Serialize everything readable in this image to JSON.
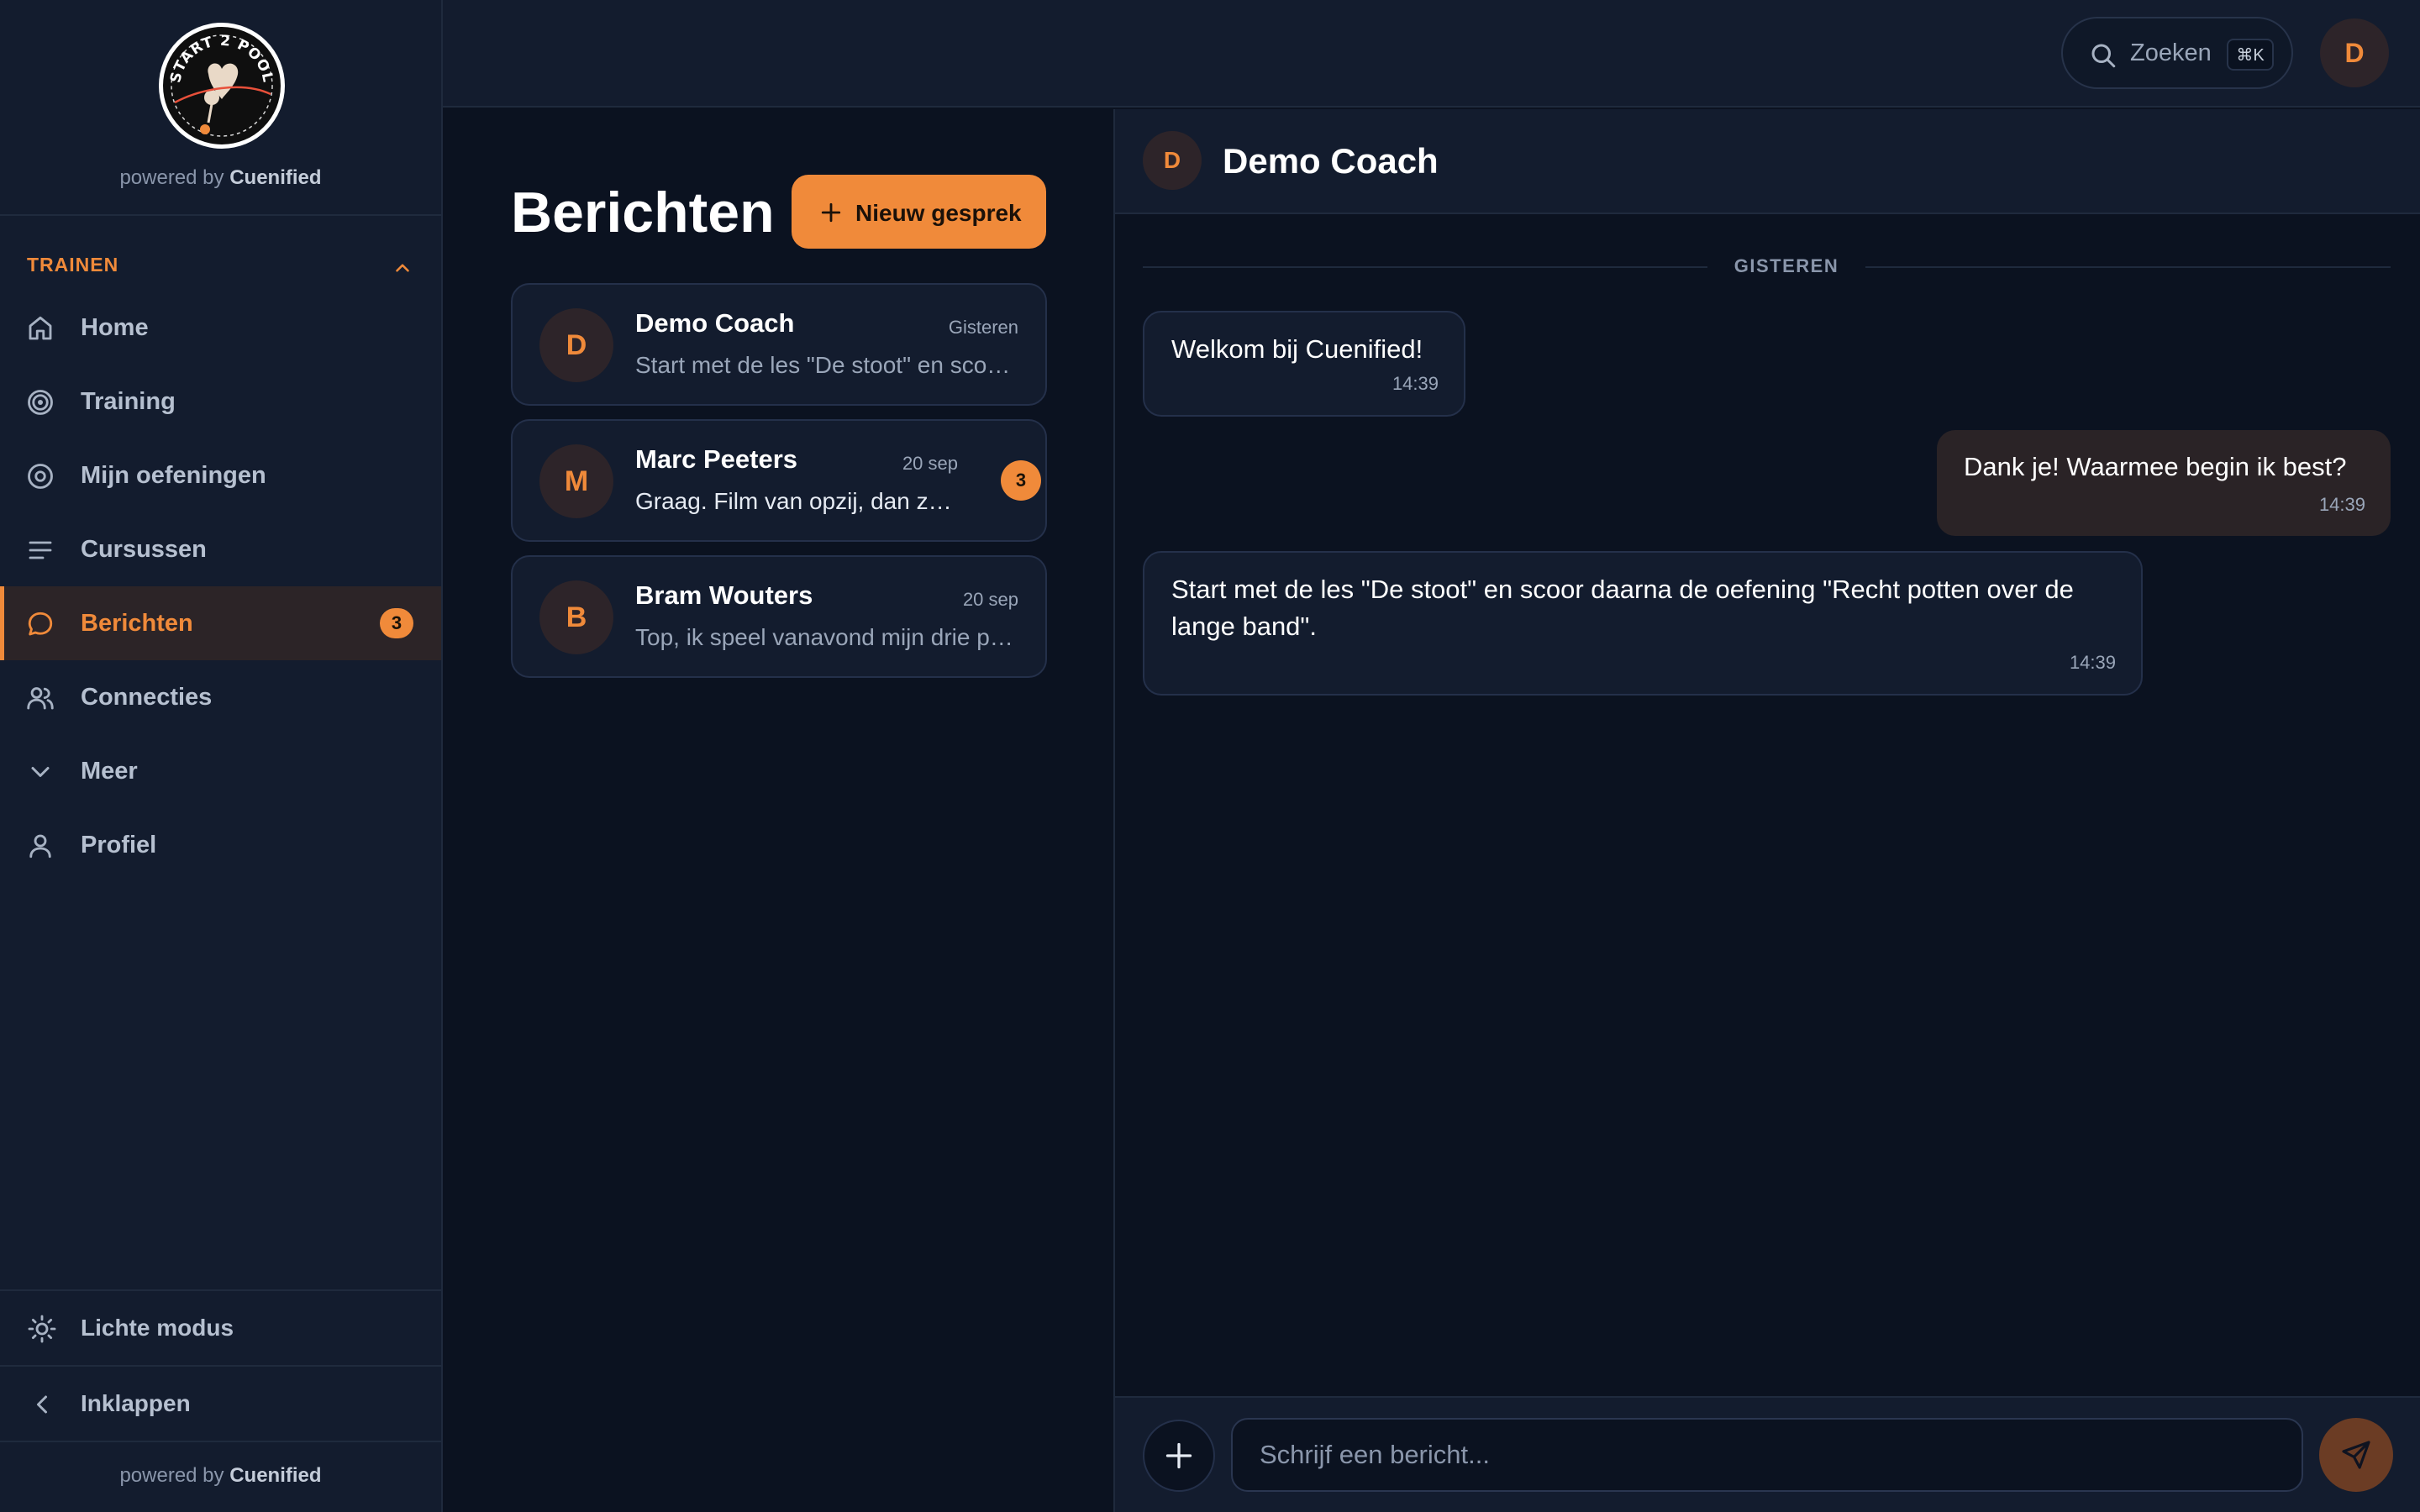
{
  "brand": {
    "logo_text": "START 2 POOL",
    "powered_prefix": "powered by",
    "powered_name": "Cuenified"
  },
  "colors": {
    "accent": "#f08a3a",
    "sidebar_bg": "#131c2e",
    "page_bg": "#0b1220"
  },
  "sidebar": {
    "section_title": "TRAINEN",
    "items": [
      {
        "label": "Home",
        "icon": "home-icon"
      },
      {
        "label": "Training",
        "icon": "target-icon"
      },
      {
        "label": "Mijn oefeningen",
        "icon": "circle-dot-icon"
      },
      {
        "label": "Cursussen",
        "icon": "list-icon"
      },
      {
        "label": "Berichten",
        "icon": "message-icon",
        "badge": "3",
        "active": true
      },
      {
        "label": "Connecties",
        "icon": "users-icon"
      },
      {
        "label": "Meer",
        "icon": "chevron-down-icon"
      },
      {
        "label": "Profiel",
        "icon": "user-icon"
      }
    ],
    "theme_toggle": "Lichte modus",
    "collapse": "Inklappen"
  },
  "topbar": {
    "search_label": "Zoeken",
    "search_shortcut": "⌘K",
    "user_initial": "D"
  },
  "conversations": {
    "title": "Berichten",
    "new_button": "Nieuw gesprek",
    "items": [
      {
        "initial": "D",
        "name": "Demo Coach",
        "date": "Gisteren",
        "preview": "Start met de les \"De stoot\" en scoor daarna de oefening",
        "unread": null
      },
      {
        "initial": "M",
        "name": "Marc Peeters",
        "date": "20 sep",
        "preview": "Graag. Film van opzij, dan zie ik je stoot beter",
        "unread": "3"
      },
      {
        "initial": "B",
        "name": "Bram Wouters",
        "date": "20 sep",
        "preview": "Top, ik speel vanavond mijn drie partijen",
        "unread": null
      }
    ]
  },
  "chat": {
    "initial": "D",
    "name": "Demo Coach",
    "day_label": "GISTEREN",
    "messages": [
      {
        "direction": "in",
        "text": "Welkom bij Cuenified!",
        "time": "14:39"
      },
      {
        "direction": "out",
        "text": "Dank je! Waarmee begin ik best?",
        "time": "14:39"
      },
      {
        "direction": "in",
        "text": "Start met de les \"De stoot\" en scoor daarna de oefening \"Recht potten over de lange band\".",
        "time": "14:39"
      }
    ],
    "input_placeholder": "Schrijf een bericht..."
  }
}
